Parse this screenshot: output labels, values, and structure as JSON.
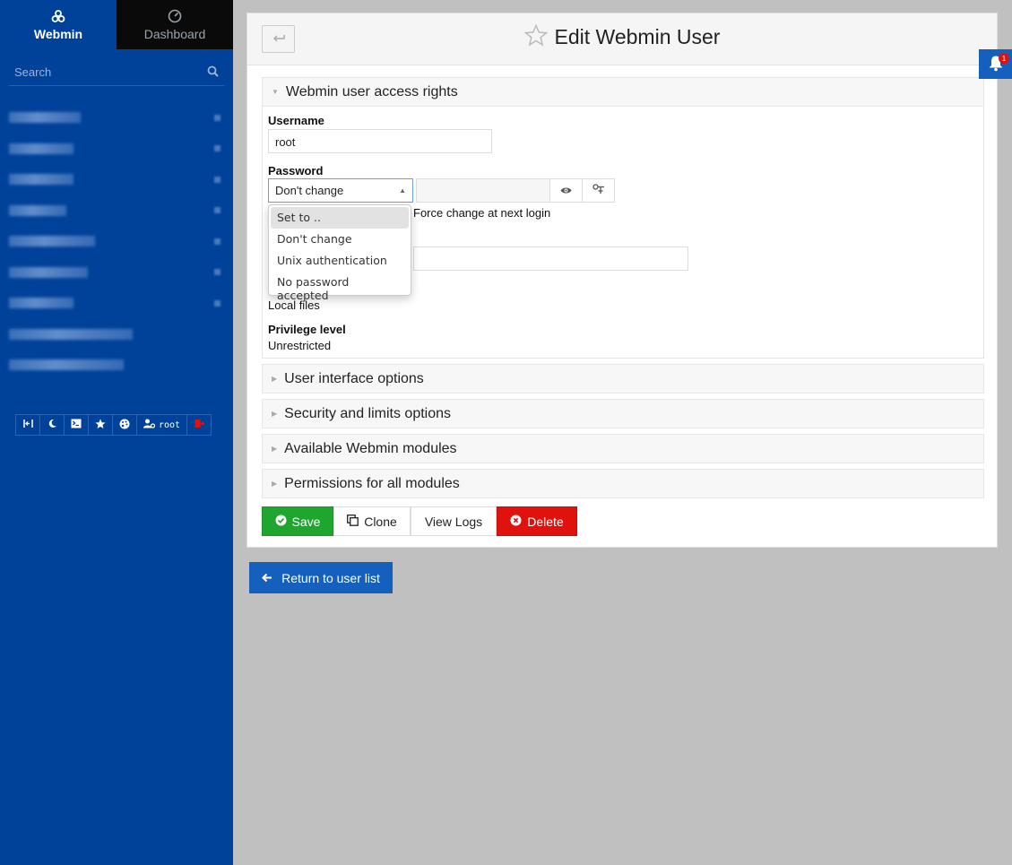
{
  "sidebar": {
    "tabs": [
      {
        "label": "Webmin",
        "icon": "webmin-logo-icon"
      },
      {
        "label": "Dashboard",
        "icon": "dashboard-gauge-icon"
      }
    ],
    "search_placeholder": "Search",
    "toolbar": {
      "username": "root"
    }
  },
  "header": {
    "title": "Edit Webmin User"
  },
  "sections": {
    "access_rights": "Webmin user access rights",
    "ui_options": "User interface options",
    "security": "Security and limits options",
    "modules": "Available Webmin modules",
    "permissions": "Permissions for all modules"
  },
  "form": {
    "username_label": "Username",
    "username_value": "root",
    "password_label": "Password",
    "password_mode": "Don't change",
    "force_change_label": "Force change at next login",
    "local_files": "Local files",
    "privilege_label": "Privilege level",
    "privilege_value": "Unrestricted"
  },
  "password_dropdown": {
    "options": [
      "Set to ..",
      "Don't change",
      "Unix authentication",
      "No password accepted"
    ],
    "highlighted": "Set to .."
  },
  "actions": {
    "save": "Save",
    "clone": "Clone",
    "view_logs": "View Logs",
    "delete": "Delete",
    "return": "Return to user list"
  },
  "notifications": {
    "count": "1"
  },
  "colors": {
    "sidebar_bg": "#00429a",
    "save": "#1fa62f",
    "delete": "#e0120e",
    "primary": "#1560bd"
  }
}
